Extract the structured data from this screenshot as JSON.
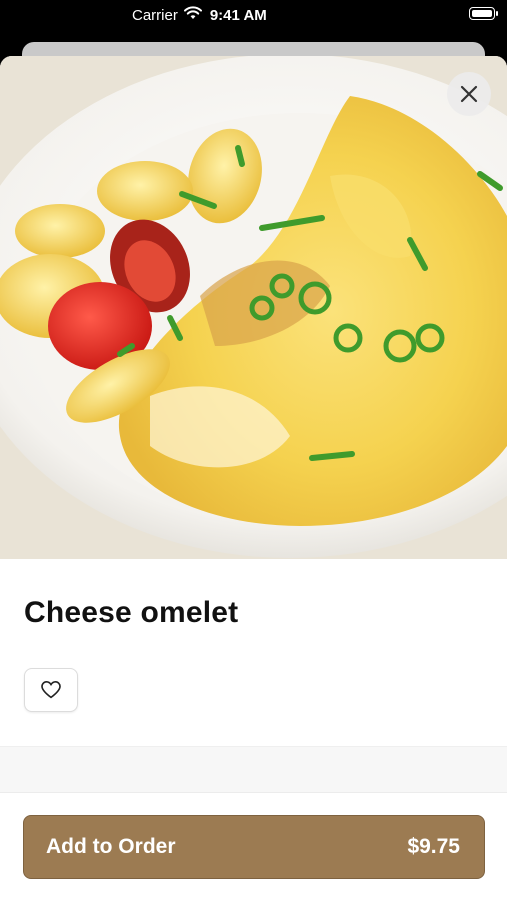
{
  "status_bar": {
    "carrier": "Carrier",
    "time": "9:41 AM",
    "wifi_icon": "wifi-icon",
    "battery_icon": "battery-icon"
  },
  "hero": {
    "image": "cheese-omelet-photo",
    "close_icon": "close-icon"
  },
  "item": {
    "title": "Cheese omelet",
    "favorite_icon": "heart-icon"
  },
  "footer": {
    "add_label": "Add to Order",
    "price": "$9.75"
  },
  "colors": {
    "accent": "#9c7b52",
    "accent_border": "#7e6240",
    "title_text": "#111111",
    "background": "#ffffff"
  }
}
